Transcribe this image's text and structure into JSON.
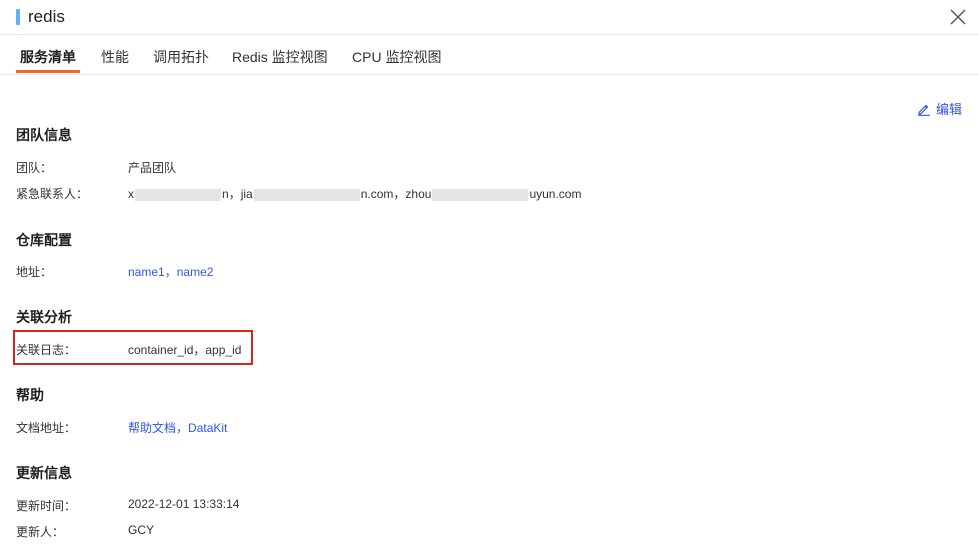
{
  "window": {
    "title": "redis"
  },
  "tabs": [
    {
      "label": "服务清单",
      "active": true
    },
    {
      "label": "性能",
      "active": false
    },
    {
      "label": "调用拓扑",
      "active": false
    },
    {
      "label": "Redis 监控视图",
      "active": false
    },
    {
      "label": "CPU 监控视图",
      "active": false
    }
  ],
  "toolbar": {
    "edit_label": "编辑"
  },
  "sections": {
    "team": {
      "title": "团队信息",
      "team_label": "团队：",
      "team_value": "产品团队",
      "contact_label": "紧急联系人：",
      "contacts": [
        {
          "prefix": "x",
          "suffix": "n",
          "sep": "，"
        },
        {
          "prefix": "jia",
          "suffix": "n.com",
          "sep": "，"
        },
        {
          "prefix": "zhou",
          "suffix": "uyun.com",
          "sep": ""
        }
      ]
    },
    "repo": {
      "title": "仓库配置",
      "address_label": "地址：",
      "addresses": [
        "name1",
        "name2"
      ],
      "sep": "，"
    },
    "related": {
      "title": "关联分析",
      "logs_label": "关联日志：",
      "logs_value": "container_id，app_id"
    },
    "help": {
      "title": "帮助",
      "docs_label": "文档地址：",
      "docs": [
        "帮助文档",
        "DataKit"
      ],
      "sep": "，"
    },
    "update": {
      "title": "更新信息",
      "time_label": "更新时间：",
      "time_value": "2022-12-01 13:33:14",
      "by_label": "更新人：",
      "by_value": "GCY"
    }
  },
  "colors": {
    "accent_tab": "#f2622a",
    "link": "#2f54eb",
    "title_bar": "#5fb0f5",
    "highlight": "#d9261c"
  },
  "icons": {
    "close": "close-icon",
    "edit": "pencil-icon"
  }
}
